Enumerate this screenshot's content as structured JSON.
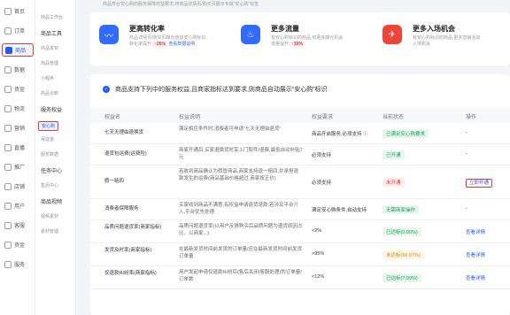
{
  "rail": {
    "items": [
      {
        "label": "首页",
        "active": false
      },
      {
        "label": "订单",
        "active": false
      },
      {
        "label": "商品",
        "active": true
      },
      {
        "label": "数据",
        "active": false
      },
      {
        "label": "资金",
        "active": false
      },
      {
        "label": "物流",
        "active": false
      },
      {
        "label": "营销",
        "active": false
      },
      {
        "label": "直播",
        "active": false
      },
      {
        "label": "推广",
        "active": false
      },
      {
        "label": "店铺",
        "active": false
      },
      {
        "label": "用户",
        "active": false
      },
      {
        "label": "客服",
        "active": false
      },
      {
        "label": "资金",
        "active": false
      },
      {
        "label": "服务",
        "active": false
      }
    ]
  },
  "subnav": {
    "items": [
      {
        "label": "商品工作台",
        "kind": "sub"
      },
      {
        "label": "商品工具",
        "kind": "group"
      },
      {
        "label": "商品发布",
        "kind": "sub"
      },
      {
        "label": "商品管理",
        "kind": "sub"
      },
      {
        "label": "小程序",
        "kind": "sub"
      },
      {
        "label": "商品诊断",
        "kind": "sub"
      },
      {
        "label": "服务权益",
        "kind": "group"
      },
      {
        "label": "安心购",
        "kind": "active"
      },
      {
        "label": "保证金",
        "kind": "sub"
      },
      {
        "label": "服务数据",
        "kind": "sub"
      },
      {
        "label": "任务中心",
        "kind": "group"
      },
      {
        "label": "售后中心",
        "kind": "sub"
      },
      {
        "label": "商品视频",
        "kind": "group"
      },
      {
        "label": "视频素材",
        "kind": "sub"
      },
      {
        "label": "素材管理",
        "kind": "sub"
      }
    ]
  },
  "banner": {
    "desc": "商品符合安心购的服务保障权益要求,将商品详情页/购买页展示专属“安心购”标签"
  },
  "cards": [
    {
      "title": "更高转化率",
      "line1": "商品详情页/购买页曝光增加安心购标识,",
      "line2": "转化率提升",
      "chip": "↑26%",
      "note": "查看数据说明",
      "color": "#2f6bff",
      "icon": "〰"
    },
    {
      "title": "更多流量",
      "line1": "有安心购标识的商品,有更多曝光机会",
      "line2": "流量提升",
      "chip": "↑30%",
      "note": "",
      "color": "#2f6bff",
      "icon": "♨"
    },
    {
      "title": "更多入场机会",
      "line1": "有安心购标识的商品,更多营销活动",
      "line2": "入场机会",
      "chip": "",
      "note": "",
      "color": "#f04438",
      "icon": "✈"
    }
  ],
  "hint": "商品支持下列中的服务权益,且商家指标达到要求,则商品自动展示“安心购”标识",
  "table": {
    "headers": [
      "权益名",
      "权益说明",
      "权益要求",
      "当前状态",
      "操作"
    ],
    "rows": [
      {
        "name": "七天无理由退换货",
        "desc": "满足相应条件时,消费者可申请“七天无理由退货”",
        "req": "商品开启服务,必须支持 ⓘ",
        "status": "已满足安心购要求",
        "status_kind": "green",
        "op": "-"
      },
      {
        "name": "退货包运费(运费险)",
        "desc": "商家开通后,买家退换货时享上门取件/退费,最低自动补贴7元",
        "req": "必须支持",
        "status": "已开通",
        "status_kind": "green",
        "op": "-"
      },
      {
        "name": "假一赔四",
        "desc": "若收到商品确认为假冒商品,商家支持退一赔四,并承担退款发生的运费(商品基础价格超过,商家按正价)",
        "req": "必须支持",
        "status": "未开通",
        "status_kind": "red",
        "op": "立即开通"
      },
      {
        "name": "消费者保障服务",
        "desc": "买家收到商品不满意,有权益申请退货退款;若涉及平台介入,平台优先处理",
        "req": "满足安心购条件,自动支持",
        "status": "无需商家操作",
        "status_kind": "green",
        "op": "-"
      },
      {
        "name": "品质问题退货率(商家指标)",
        "desc": "品质问题退货率(以用户反馈购买后品质问题为退货原因占比、以商家...)",
        "req": "<2%",
        "status": "已达标(0.00%)",
        "status_kind": "green",
        "op": "查看详情"
      },
      {
        "name": "发货及时率(商家指标)",
        "desc": "在最新发货时间前发货的订单量/应在最新发货时间前发货订单量",
        "req": ">95%",
        "status": "未达标(66.67%)",
        "status_kind": "yellow",
        "op": "查看详情"
      },
      {
        "name": "仅退款纠纷率(商家指标)",
        "desc": "用户发起申请仅退款纠纷后(售后关闭/客服处理)的订单量/订单数",
        "req": "<12%",
        "status": "已达标(7.09%)",
        "status_kind": "green",
        "op": "查看详情"
      }
    ]
  }
}
